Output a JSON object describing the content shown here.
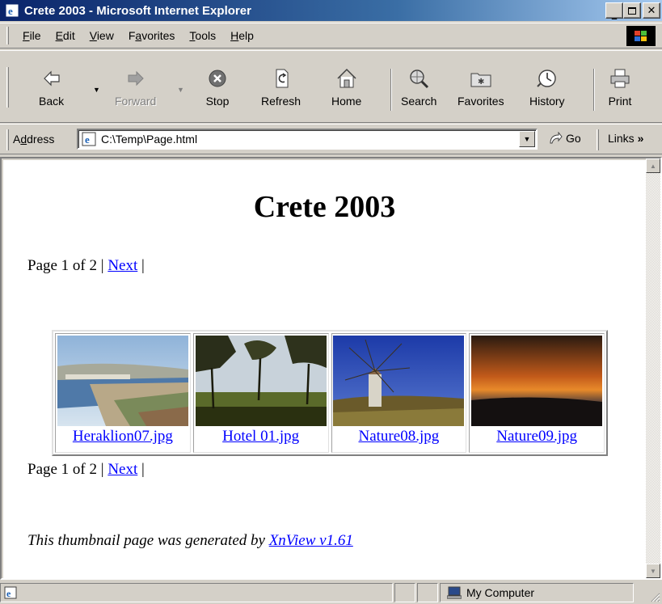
{
  "window": {
    "title": "Crete 2003 - Microsoft Internet Explorer"
  },
  "menu": [
    {
      "label": "File",
      "accel": "F",
      "rest": "ile"
    },
    {
      "label": "Edit",
      "accel": "E",
      "rest": "dit"
    },
    {
      "label": "View",
      "accel": "V",
      "rest": "iew"
    },
    {
      "label": "Favorites",
      "pre": "F",
      "accel": "a",
      "rest": "vorites"
    },
    {
      "label": "Tools",
      "accel": "T",
      "rest": "ools"
    },
    {
      "label": "Help",
      "accel": "H",
      "rest": "elp"
    }
  ],
  "toolbar": {
    "back": "Back",
    "forward": "Forward",
    "stop": "Stop",
    "refresh": "Refresh",
    "home": "Home",
    "search": "Search",
    "favorites": "Favorites",
    "history": "History",
    "print": "Print"
  },
  "address": {
    "label_pre": "A",
    "label_accel": "d",
    "label_rest": "dress",
    "url": "C:\\Temp\\Page.html",
    "go": "Go",
    "links": "Links"
  },
  "page": {
    "title": "Crete 2003",
    "pager_text": "Page 1 of 2 | ",
    "pager_next": "Next",
    "pager_tail": " |",
    "thumbnails": [
      {
        "name": "Heraklion07.jpg",
        "icon": "harbor-photo"
      },
      {
        "name": "Hotel 01.jpg",
        "icon": "trees-photo"
      },
      {
        "name": "Nature08.jpg",
        "icon": "windmill-photo"
      },
      {
        "name": "Nature09.jpg",
        "icon": "sunset-photo"
      }
    ],
    "footer_text": "This thumbnail page was generated by ",
    "footer_link": "XnView v1.61"
  },
  "status": {
    "zone": "My Computer"
  },
  "colors": {
    "titlebar_start": "#0a246a",
    "titlebar_end": "#a6caf0",
    "link": "#0000ff",
    "chrome": "#d4d0c8"
  }
}
